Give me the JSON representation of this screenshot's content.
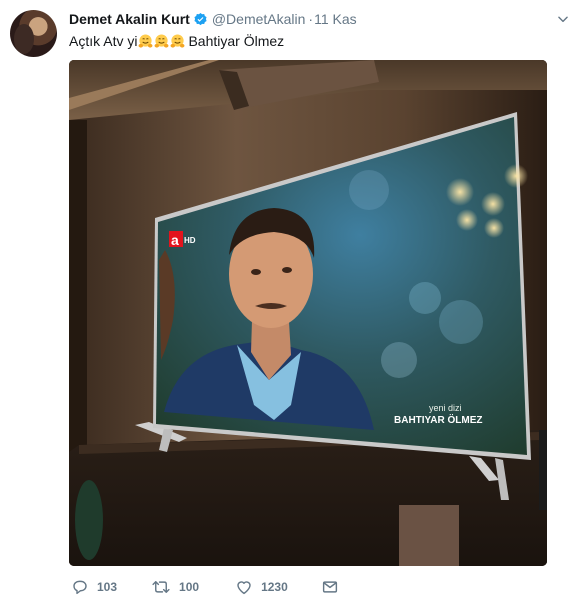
{
  "tweet": {
    "author_name": "Demet Akalin Kurt",
    "handle": "@DemetAkalin",
    "separator": "·",
    "time": "11 Kas",
    "text_before": "Açtık Atv yi",
    "text_after": "Bahtiyar Ölmez",
    "emoji_count": 3
  },
  "media": {
    "channel_logo": "a",
    "channel_hd": "HD",
    "overlay_line1": "yeni dizi",
    "overlay_line2": "BAHTIYAR ÖLMEZ"
  },
  "actions": {
    "replies": "103",
    "retweets": "100",
    "likes": "1230"
  },
  "colors": {
    "verified": "#1da1f2",
    "text": "#14171a",
    "secondary": "#657786",
    "channel_red": "#e2141d"
  },
  "icons": [
    "verified-badge-icon",
    "chevron-down-icon",
    "reply-icon",
    "retweet-icon",
    "heart-icon",
    "envelope-icon",
    "hugging-face-emoji"
  ]
}
